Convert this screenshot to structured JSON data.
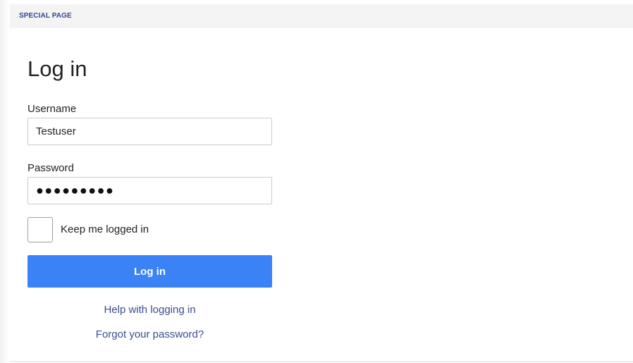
{
  "header": {
    "special_label": "SPECIAL PAGE"
  },
  "form": {
    "title": "Log in",
    "username_label": "Username",
    "username_value": "Testuser",
    "password_label": "Password",
    "password_value": "●●●●●●●●●",
    "remember_label": "Keep me logged in",
    "remember_checked": false,
    "submit_label": "Log in",
    "help_link": "Help with logging in",
    "forgot_link": "Forgot your password?"
  },
  "colors": {
    "primary_button": "#3b82f6",
    "link": "#3a4d8f",
    "header_label": "#36488f"
  }
}
